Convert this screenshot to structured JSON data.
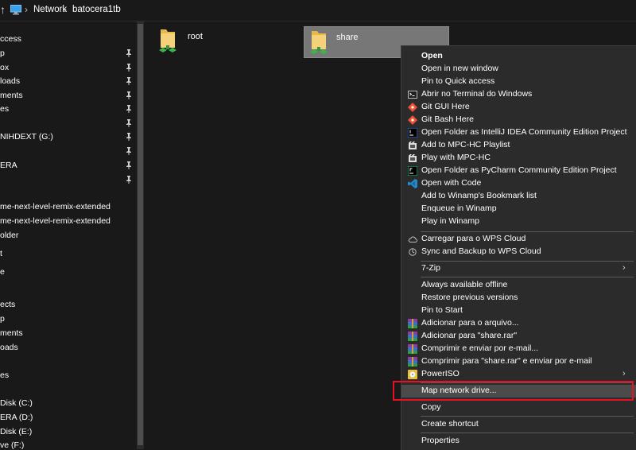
{
  "addressbar": {
    "crumbs": [
      "Network",
      "batocera1tb"
    ]
  },
  "sidebar": {
    "items": [
      "ccess",
      "p",
      "ox",
      "loads",
      "ments",
      "es",
      "NIHDEXT (G:)",
      "",
      "ERA",
      "",
      "me-next-level-remix-extended",
      "me-next-level-remix-extended",
      "older",
      "t",
      "e",
      "",
      "ects",
      "p",
      "ments",
      "oads",
      "",
      "es",
      "",
      "Disk (C:)",
      "ERA (D:)",
      "Disk (E:)",
      "ve (F:)"
    ]
  },
  "content": {
    "tiles": [
      "root",
      "share"
    ]
  },
  "menu": {
    "items": [
      "Open",
      "Open in new window",
      "Pin to Quick access",
      "Abrir no Terminal do Windows",
      "Git GUI Here",
      "Git Bash Here",
      "Open Folder as IntelliJ IDEA Community Edition Project",
      "Add to MPC-HC Playlist",
      "Play with MPC-HC",
      "Open Folder as PyCharm Community Edition Project",
      "Open with Code",
      "Add to Winamp's Bookmark list",
      "Enqueue in Winamp",
      "Play in Winamp",
      "Carregar para o WPS Cloud",
      "Sync and Backup to WPS Cloud",
      "7-Zip",
      "Always available offline",
      "Restore previous versions",
      "Pin to Start",
      "Adicionar para o arquivo...",
      "Adicionar para \"share.rar\"",
      "Comprimir e enviar por e-mail...",
      "Comprimir para \"share.rar\" e enviar por e-mail",
      "PowerISO",
      "Map network drive...",
      "Copy",
      "Create shortcut",
      "Properties"
    ]
  },
  "colors": {
    "background": "#191919",
    "menu_background": "#2b2b2b",
    "highlight_border": "#e81123",
    "selected_tile": "#777777"
  },
  "icons": [
    "back-arrow-icon",
    "computer-icon",
    "chevron-right-icon",
    "pin-icon",
    "network-folder-icon",
    "terminal-icon",
    "git-icon",
    "intellij-icon",
    "mpc-hc-icon",
    "pycharm-icon",
    "vscode-icon",
    "cloud-icon",
    "sync-icon",
    "winrar-icon",
    "poweriso-icon"
  ]
}
